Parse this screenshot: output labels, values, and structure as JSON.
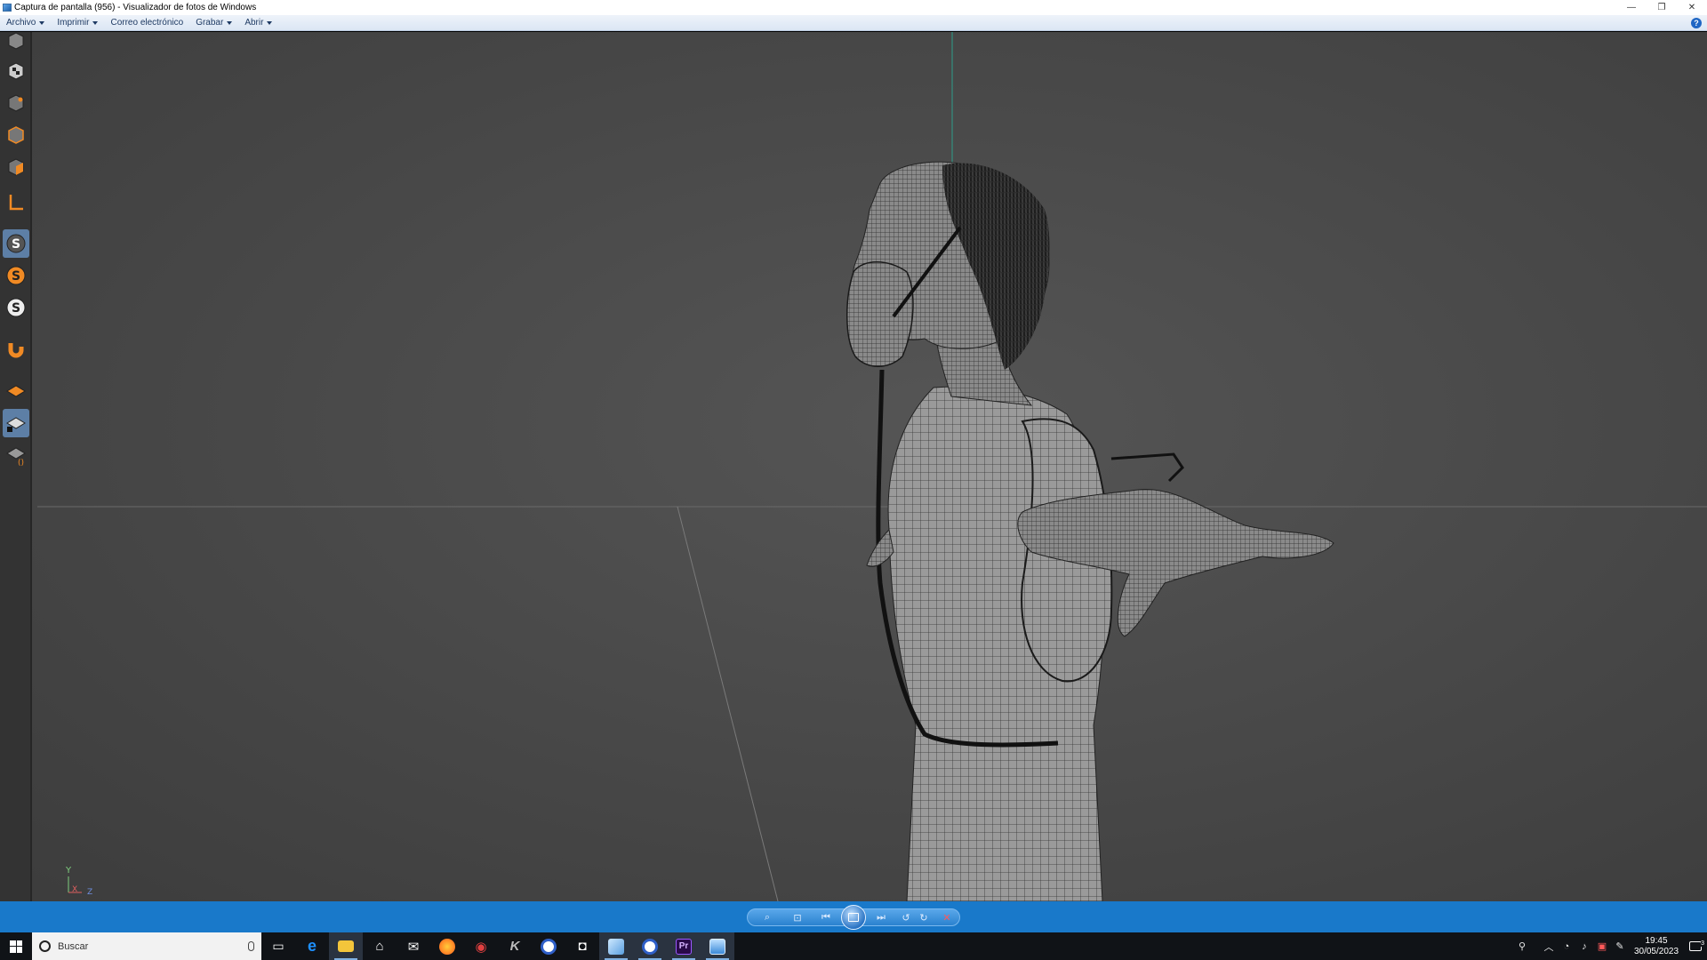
{
  "window": {
    "title": "Captura de pantalla (956) - Visualizador de fotos de Windows",
    "app_icon": "photo-viewer-icon",
    "controls": [
      "minimize-icon",
      "restore-icon",
      "close-icon"
    ]
  },
  "menu": {
    "items": [
      {
        "label": "Archivo",
        "dropdown": true
      },
      {
        "label": "Imprimir",
        "dropdown": true
      },
      {
        "label": "Correo electrónico",
        "dropdown": false
      },
      {
        "label": "Grabar",
        "dropdown": true
      },
      {
        "label": "Abrir",
        "dropdown": true
      }
    ],
    "help_label": "?"
  },
  "viewer_image": {
    "content": "3D wireframe character model viewport",
    "axis_labels": {
      "y": "Y",
      "x": "X",
      "z": "Z"
    },
    "toolbar_icons": [
      "cube-icon",
      "checker-cube-icon",
      "point-cube-icon",
      "edge-cube-icon",
      "poly-cube-icon",
      "axis-icon",
      "snap-s-icon",
      "snap-s-orange-icon",
      "snap-s-white-icon",
      "magnet-icon",
      "workplane-icon",
      "workplane-lock-icon",
      "workplane-axis-icon"
    ]
  },
  "navbar": {
    "buttons": [
      "zoom-icon",
      "actual-size-icon",
      "previous-icon",
      "slideshow-icon",
      "next-icon",
      "rotate-left-icon",
      "rotate-right-icon",
      "delete-icon"
    ]
  },
  "taskbar": {
    "search_placeholder": "Buscar",
    "apps": [
      {
        "name": "task-view-icon",
        "color": "#ffffff",
        "glyph": "▭"
      },
      {
        "name": "edge-icon",
        "color": "#1e90ff",
        "glyph": "e"
      },
      {
        "name": "file-explorer-icon",
        "color": "#f3c53b",
        "glyph": "▬"
      },
      {
        "name": "store-icon",
        "color": "#ffffff",
        "glyph": "⌂"
      },
      {
        "name": "mail-icon",
        "color": "#ffffff",
        "glyph": "✉"
      },
      {
        "name": "firefox-icon",
        "color": "#ff7a1a",
        "glyph": "●"
      },
      {
        "name": "app-red-icon",
        "color": "#e04040",
        "glyph": "◉"
      },
      {
        "name": "app-k-icon",
        "color": "#bbbbbb",
        "glyph": "K"
      },
      {
        "name": "cinema4d-icon",
        "color": "#3f6fd8",
        "glyph": "◎"
      },
      {
        "name": "app-camera-icon",
        "color": "#ffffff",
        "glyph": "◘"
      },
      {
        "name": "app-blue-icon",
        "color": "#9fd0f5",
        "glyph": "◆"
      },
      {
        "name": "cinema4d-2-icon",
        "color": "#3f6fd8",
        "glyph": "◎"
      },
      {
        "name": "premiere-icon",
        "color": "#9b59ff",
        "glyph": "Pr"
      },
      {
        "name": "photo-viewer-icon",
        "color": "#6fb4ff",
        "glyph": "▣"
      }
    ],
    "tray_icons": [
      "people-icon",
      "chevron-up-icon",
      "network-icon",
      "volume-icon",
      "battery-warning-icon",
      "pen-icon"
    ],
    "time": "19:45",
    "date": "30/05/2023",
    "notification_count": "3"
  }
}
